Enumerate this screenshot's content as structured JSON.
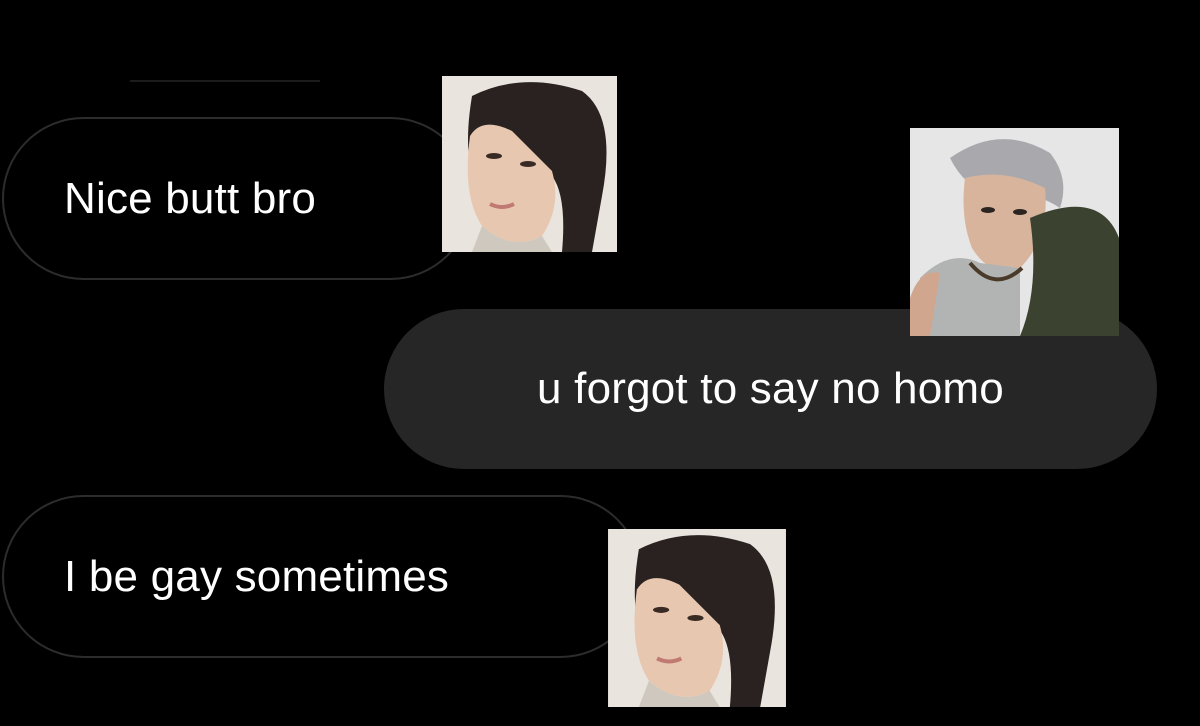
{
  "conversation": {
    "messages": [
      {
        "sender": "contact-a",
        "direction": "received",
        "text": "Nice butt bro"
      },
      {
        "sender": "contact-b",
        "direction": "sent",
        "text": "u forgot to say no homo"
      },
      {
        "sender": "contact-a",
        "direction": "received",
        "text": "I be gay sometimes"
      }
    ]
  },
  "colors": {
    "background": "#000000",
    "received_bubble_border": "#2c2c2c",
    "sent_bubble_fill": "#262626",
    "text": "#ffffff"
  },
  "icons": {
    "avatar_a": "avatar-photo-icon",
    "avatar_b": "avatar-photo-icon"
  }
}
